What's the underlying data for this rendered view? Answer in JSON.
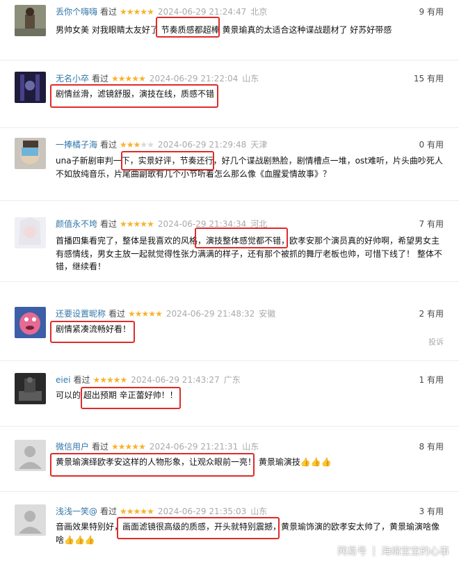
{
  "colors": {
    "username": "#3377aa",
    "star": "#f7b32c",
    "star_off": "#d8d8d8",
    "meta_gray": "#aaaaaa",
    "highlight": "#e02a2a"
  },
  "reviews": [
    {
      "username": "丢你个嗨嗨",
      "watched": "看过",
      "rating": 5,
      "time": "2024-06-29 21:24:47",
      "location": "北京",
      "useful": "9 有用",
      "body": "男帅女美 对我眼睛太友好了 节奏质感都超棒 黄景瑜真的太适合这种谍战题材了 好苏好带感"
    },
    {
      "username": "无名小卒",
      "watched": "看过",
      "rating": 5,
      "time": "2024-06-29 21:22:04",
      "location": "山东",
      "useful": "15 有用",
      "body": "剧情丝滑，滤镜舒服，演技在线，质感不错"
    },
    {
      "username": "一捧橘子海",
      "watched": "看过",
      "rating": 3,
      "time": "2024-06-29 21:29:48",
      "location": "天津",
      "useful": "0 有用",
      "body": "una子新剧审判一下，实景好评，节奏还行，好几个谍战剧熟脸，剧情槽点一堆，ost难听，片头曲吵死人不如放纯音乐，片尾曲副歌有几个小节听着怎么那么像《血腥爱情故事》？"
    },
    {
      "username": "颜值永不垮",
      "watched": "看过",
      "rating": 5,
      "time": "2024-06-29 21:34:34",
      "location": "河北",
      "useful": "7 有用",
      "body": "首播四集看完了，整体是我喜欢的风格，演技整体感觉都不错，欧孝安那个演员真的好帅啊，希望男女主有感情线，男女主放一起就觉得性张力满满的样子，还有那个被抓的舞厅老板也帅，可惜下线了！ 整体不错，继续看！"
    },
    {
      "username": "还要设置昵称",
      "watched": "看过",
      "rating": 5,
      "time": "2024-06-29 21:48:32",
      "location": "安徽",
      "useful": "2 有用",
      "body": "剧情紧凑流畅好看！",
      "report": "投诉"
    },
    {
      "username": "eiei",
      "watched": "看过",
      "rating": 5,
      "time": "2024-06-29 21:43:27",
      "location": "广东",
      "useful": "1 有用",
      "body": "可以的 超出预期 辛正蕾好帅！！"
    },
    {
      "username": "微信用户",
      "watched": "看过",
      "rating": 5,
      "time": "2024-06-29 21:21:31",
      "location": "山东",
      "useful": "8 有用",
      "body": "黄景瑜演绎欧孝安这样的人物形象，让观众眼前一亮！ 黄景瑜演技👍👍👍"
    },
    {
      "username": "浅浅一笑@",
      "watched": "看过",
      "rating": 5,
      "time": "2024-06-29 21:35:03",
      "location": "山东",
      "useful": "3 有用",
      "body": "音画效果特别好，画面滤镜很高级的质感，开头就特别震撼，黄景瑜饰演的欧孝安太帅了，黄景瑜演啥像啥👍👍👍"
    }
  ],
  "watermark": {
    "logo": "网易号",
    "separator": "|",
    "author": "海绵宝宝的心事"
  }
}
